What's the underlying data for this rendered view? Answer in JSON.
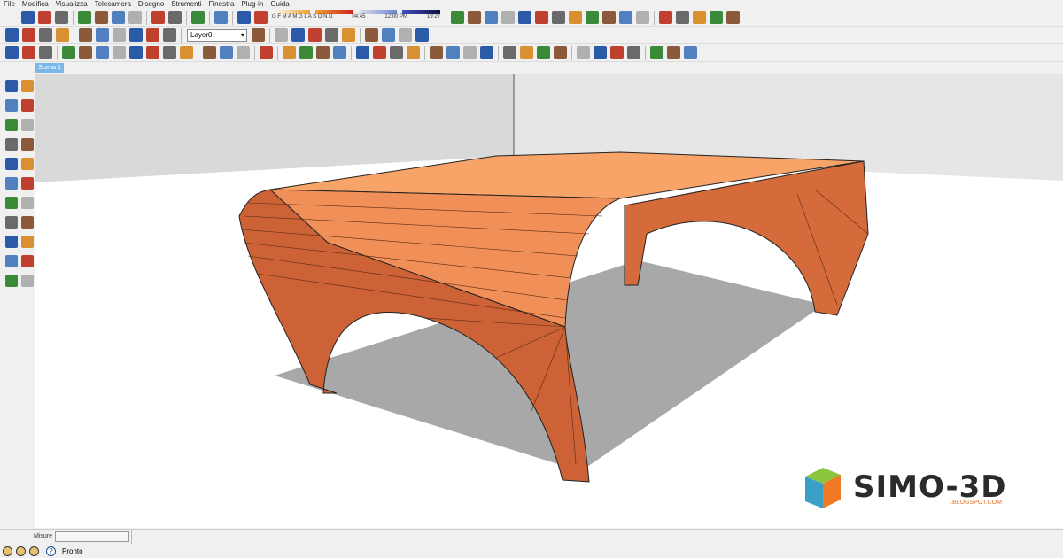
{
  "menu": [
    "File",
    "Modifica",
    "Visualizza",
    "Telecamera",
    "Disegno",
    "Strumenti",
    "Finestra",
    "Plug-in",
    "Guida"
  ],
  "toolbar": {
    "row1": [
      "new-icon",
      "open-icon",
      "save-icon",
      "|",
      "cut-icon",
      "copy-icon",
      "paste-icon",
      "erase-icon",
      "|",
      "undo-icon",
      "redo-icon",
      "|",
      "print-icon",
      "|",
      "info-icon",
      "|",
      "component-icon",
      "model-info-icon",
      "shadows",
      "|",
      "draw-line-icon",
      "arc-icon",
      "curve-icon",
      "zigzag-icon",
      "curve-icon",
      "arc-icon",
      "rectangle-icon",
      "arc-icon",
      "curve-icon",
      "curve-icon",
      "arc-icon",
      "arc-icon",
      "|",
      "curve-icon",
      "curve-icon",
      "wrench-icon",
      "circle-icon",
      "polygon-icon"
    ],
    "row2": [
      "color-picker-icon",
      "paint-tool-icon",
      "color-picker-icon",
      "paint-tool-icon",
      "|",
      "iso-view-icon",
      "front-view-icon",
      "top-view-icon",
      "right-view-icon",
      "back-view-icon",
      "left-view-icon",
      "|",
      "layer",
      "layer-manager-icon",
      "|",
      "push-j-icon",
      "push-v-icon",
      "push-n-icon",
      "follow-icon",
      "follow-icon",
      "|",
      "xray-icon",
      "wireframe-icon",
      "hidden-line-icon",
      "axes-icon"
    ],
    "row3": [
      "sandbox-icon",
      "geotag-icon",
      "terrain-icon",
      "|",
      "style-icon",
      "style-icon",
      "style-icon",
      "style-icon",
      "light-icon",
      "cone-icon",
      "palette-icon",
      "palette-icon",
      "|",
      "box-icon",
      "box-icon",
      "box-icon",
      "|",
      "select-icon",
      "|",
      "pencil-icon",
      "rectangle-icon",
      "circle-icon",
      "arc-icon",
      "|",
      "eraser-icon",
      "eraser-icon",
      "tape-measure-icon",
      "paint-bucket-icon",
      "|",
      "push-pull-icon",
      "move-icon",
      "rotate-icon",
      "follow-me-icon",
      "|",
      "orbit-icon",
      "pan-icon",
      "zoom-icon",
      "zoom-extents-icon",
      "|",
      "section-icon",
      "section-icon",
      "walk-icon",
      "globe-icon",
      "|",
      "component-icon",
      "component-icon",
      "component-icon"
    ],
    "layer_value": "Layer0",
    "shadow_months": "G F M A M G L A S O N D",
    "shadow_times": [
      "04:45",
      "12:00 PM",
      "19:27"
    ]
  },
  "scene_tab": "Scena 1",
  "left_toolbar": [
    "push-pull-icon",
    "axes-icon",
    "tape-measure-icon",
    "dimension-icon",
    "move-icon",
    "text-icon",
    "select-icon",
    "component-icon",
    "paint-bucket-icon",
    "eraser-icon",
    "rectangle-icon",
    "pencil-icon",
    "circle-icon",
    "arc-icon",
    "polygon-icon",
    "freehand-icon",
    "move-icon",
    "push-pull-icon",
    "rotate-icon",
    "follow-me-icon",
    "scale-icon",
    "offset-icon"
  ],
  "measures_label": "Misure",
  "measures_value": "",
  "status": {
    "text": "Pronto",
    "icons": [
      "geo-icon",
      "user-icon",
      "credits-icon",
      "help-icon"
    ]
  },
  "logo": {
    "text": "SIMO-3D",
    "sub": ".BLOGSPOT.COM"
  },
  "colors": {
    "table": "#e8844c",
    "table_top": "#f8a468",
    "shadow": "#a8a8a8",
    "wall": "#e3e3e3",
    "scene_tab": "#7cb7ea"
  }
}
